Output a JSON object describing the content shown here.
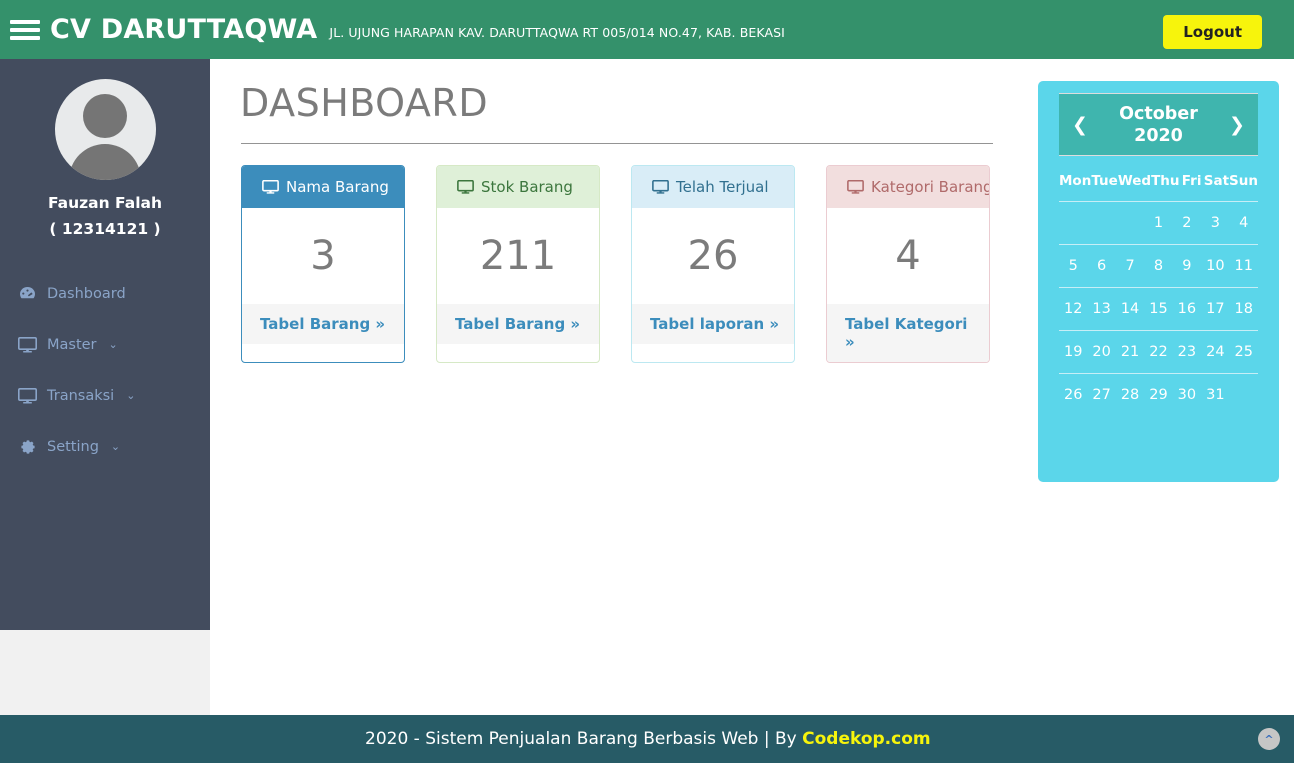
{
  "navbar": {
    "menu_toggle_icon": "hamburger-icon",
    "brand": "CV DARUTTAQWA",
    "address": "JL. UJUNG HARAPAN KAV. DARUTTAQWA RT 005/014 NO.47, KAB. BEKASI",
    "logout_label": "Logout",
    "bg_color": "#34916b",
    "logout_color": "#f7f40c"
  },
  "sidebar": {
    "avatar_icon": "user-avatar-icon",
    "user_name": "Fauzan Falah",
    "user_id": "( 12314121 )",
    "bg_color": "#434c5e",
    "items": [
      {
        "label": "Dashboard",
        "icon": "dashboard-icon",
        "caret": ""
      },
      {
        "label": "Master",
        "icon": "desktop-icon",
        "caret": "⌄"
      },
      {
        "label": "Transaksi",
        "icon": "desktop-icon",
        "caret": "⌄"
      },
      {
        "label": "Setting",
        "icon": "gear-icon",
        "caret": "⌄"
      }
    ]
  },
  "main": {
    "page_title": "DASHBOARD",
    "boxes": [
      {
        "title": "Nama Barang",
        "icon": "desktop-icon",
        "value": "3",
        "link": "Tabel Barang »",
        "variant": "ib-blue",
        "accent": "#3c8dbc"
      },
      {
        "title": "Stok Barang",
        "icon": "desktop-icon",
        "value": "211",
        "link": "Tabel Barang »",
        "variant": "ib-green",
        "accent": "#dff0d8"
      },
      {
        "title": "Telah Terjual",
        "icon": "desktop-icon",
        "value": "26",
        "link": "Tabel laporan »",
        "variant": "ib-cyan",
        "accent": "#d9edf7"
      },
      {
        "title": "Kategori Barang",
        "icon": "desktop-icon",
        "value": "4",
        "link": "Tabel Kategori »",
        "variant": "ib-red",
        "accent": "#f2dede"
      }
    ]
  },
  "calendar": {
    "prev_icon": "chevron-left-icon",
    "next_icon": "chevron-right-icon",
    "month": "October",
    "year": "2020",
    "title": "October 2020",
    "day_headers": [
      "Mon",
      "Tue",
      "Wed",
      "Thu",
      "Fri",
      "Sat",
      "Sun"
    ],
    "weeks": [
      [
        "",
        "",
        "",
        "1",
        "2",
        "3",
        "4"
      ],
      [
        "5",
        "6",
        "7",
        "8",
        "9",
        "10",
        "11"
      ],
      [
        "12",
        "13",
        "14",
        "15",
        "16",
        "17",
        "18"
      ],
      [
        "19",
        "20",
        "21",
        "22",
        "23",
        "24",
        "25"
      ],
      [
        "26",
        "27",
        "28",
        "29",
        "30",
        "31",
        ""
      ]
    ],
    "bg_color": "#5bd6ea",
    "header_color": "#3fb5ae"
  },
  "footer": {
    "text": "2020 - Sistem Penjualan Barang Berbasis Web | By ",
    "link": "Codekop.com",
    "bg_color": "#275b66",
    "scroll_top_icon": "chevron-up-icon"
  }
}
